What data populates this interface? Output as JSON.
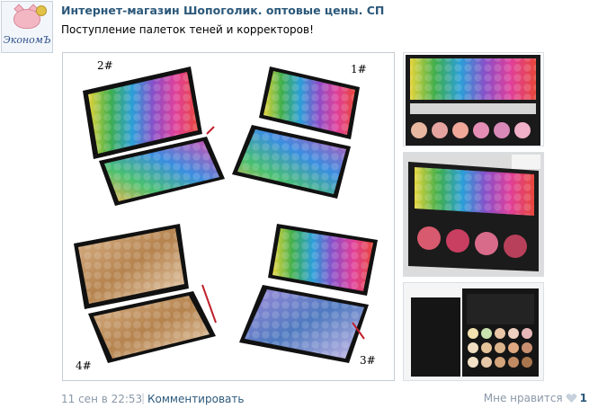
{
  "post": {
    "author": "Интернет-магазин Шопоголик. оптовые цены. СП",
    "text": "Поступление палеток теней и корректоров!",
    "avatar_logo_text": "ЭкономЪ"
  },
  "main_photo": {
    "labels": [
      "2#",
      "1#",
      "4#",
      "3#"
    ]
  },
  "footer": {
    "date": "11 сен в 22:53",
    "separator": "|",
    "comment_label": "Комментировать",
    "like_label": "Мне нравится",
    "like_count": "1"
  },
  "icons": {
    "like": "heart-icon"
  },
  "colors": {
    "link": "#2b587a",
    "muted": "#8a98a8"
  }
}
